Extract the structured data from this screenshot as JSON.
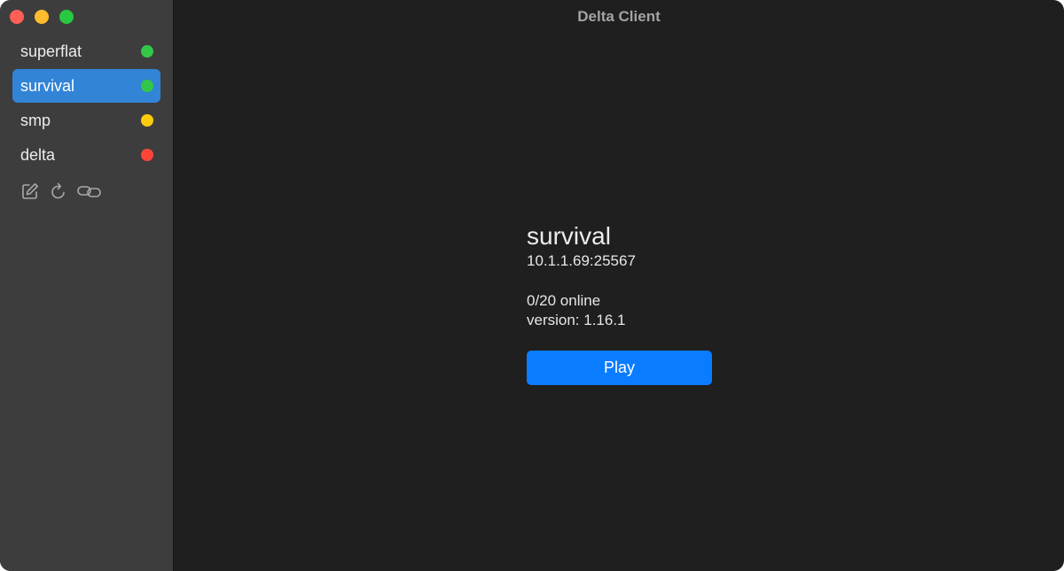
{
  "window": {
    "title": "Delta Client",
    "traffic_lights": {
      "close_color": "#ff5f57",
      "minimize_color": "#febc2e",
      "zoom_color": "#28c840"
    }
  },
  "sidebar": {
    "servers": [
      {
        "name": "superflat",
        "status": "online",
        "status_color": "#33c748",
        "selected": false
      },
      {
        "name": "survival",
        "status": "online",
        "status_color": "#33c748",
        "selected": true
      },
      {
        "name": "smp",
        "status": "pending",
        "status_color": "#fecc0a",
        "selected": false
      },
      {
        "name": "delta",
        "status": "offline",
        "status_color": "#ff453a",
        "selected": false
      }
    ],
    "toolbar": {
      "icons": [
        "edit-icon",
        "refresh-icon",
        "link-icon"
      ]
    }
  },
  "detail": {
    "name": "survival",
    "address": "10.1.1.69:25567",
    "players": "0/20 online",
    "version": "version: 1.16.1",
    "play_label": "Play"
  },
  "colors": {
    "accent": "#0a7cff",
    "selection": "#3284d6",
    "sidebar_bg": "#3d3d3d",
    "content_bg": "#1f1f1f"
  }
}
